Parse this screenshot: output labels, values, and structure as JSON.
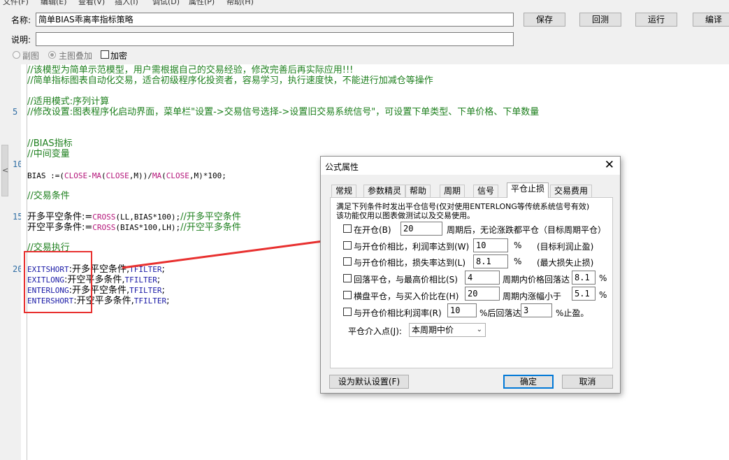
{
  "menu": [
    "文件(F)",
    "编辑(E)",
    "查看(V)",
    "插入(I)",
    "调试(D)",
    "属性(P)",
    "帮助(H)"
  ],
  "form": {
    "name_label": "名称:",
    "name_value": "简单BIAS乖离率指标策略",
    "desc_label": "说明:",
    "desc_value": "",
    "radio_sub": "副图",
    "radio_main": "主图叠加",
    "encrypt": "加密"
  },
  "toolbar": {
    "save": "保存",
    "backtest": "回测",
    "run": "运行",
    "compile": "编译"
  },
  "gutter": {
    "n5": "5",
    "n10": "10",
    "n15": "15",
    "n20": "20",
    "collapse": "<"
  },
  "code": {
    "l1": "//该模型为简单示范模型，用户需根据自己的交易经验，修改完善后再实际应用!!!",
    "l2": "//简单指标图表自动化交易，适合初级程序化投资者，容易学习，执行速度快，不能进行加减仓等操作",
    "l4": "//适用模式:序列计算",
    "l5": "//修改设置:图表程序化启动界面，菜单栏\"设置->交易信号选择->设置旧交易系统信号\"，可设置下单类型、下单价格、下单数量",
    "l8": "//BIAS指标",
    "l9": "//中间变量",
    "bias": {
      "a": "BIAS :=(",
      "close1": "CLOSE",
      "minus": "-",
      "ma1": "MA",
      "p1": "(",
      "close2": "CLOSE",
      "b": ",M))/",
      "ma2": "MA",
      "p2": "(",
      "close3": "CLOSE",
      "c": ",M)*100;"
    },
    "l13": "//交易条件",
    "l15a": "开多平空条件:=",
    "l15b": "CROSS",
    "l15c": "(LL,BIAS*100);",
    "l15d": "//开多平空条件",
    "l16a": "开空平多条件:=",
    "l16b": "CROSS",
    "l16c": "(BIAS*100,LH);",
    "l16d": "//开空平多条件",
    "l18": "//交易执行",
    "e1a": "EXITSHORT",
    "e1b": ":开多平空条件,",
    "e1c": "TFILTER",
    "e1d": ";",
    "e2a": "EXITLONG",
    "e2b": ":开空平多条件,",
    "e2c": "TFILTER",
    "e2d": ";",
    "e3a": "ENTERLONG",
    "e3b": ":开多平空条件,",
    "e3c": "TFILTER",
    "e3d": ";",
    "e4a": "ENTERSHORT",
    "e4b": ":开空平多条件,",
    "e4c": "TFILTER",
    "e4d": ";"
  },
  "dialog": {
    "title": "公式属性",
    "close": "✕",
    "tabs": [
      "常规",
      "参数精灵",
      "帮助",
      "周期",
      "信号",
      "平仓止损",
      "交易费用"
    ],
    "note1": "满足下列条件时发出平仓信号(仅对使用ENTERLONG等传统系统信号有效)",
    "note2": "该功能仅用以图表做测试以及交易使用。",
    "r1": {
      "a": "在开仓(B)",
      "v": "20",
      "b": "周期后，无论涨跌都平仓（目标周期平仓）"
    },
    "r2": {
      "a": "与开仓价相比，利润率达到(W)",
      "v": "10",
      "pct": "%",
      "b": "(目标利润止盈)"
    },
    "r3": {
      "a": "与开仓价相比，损失率达到(L)",
      "v": "8.1",
      "pct": "%",
      "b": "(最大损失止损)"
    },
    "r4": {
      "a": "回落平仓，与最高价相比(S)",
      "v": "4",
      "b": "周期内价格回落达",
      "v2": "8.1",
      "pct": "%"
    },
    "r5": {
      "a": "横盘平仓，与买入价比在(H)",
      "v": "20",
      "b": "周期内涨幅小于",
      "v2": "5.1",
      "pct": "%"
    },
    "r6": {
      "a": "与开仓价相比利润率(R)",
      "v": "10",
      "b": "%后回落达",
      "v2": "3",
      "c": "%止盈。"
    },
    "entry_label": "平仓介入点(J):",
    "entry_value": "本周期中价",
    "default_btn": "设为默认设置(F)",
    "ok_btn": "确定",
    "cancel_btn": "取消"
  },
  "colors": {
    "annotation": "#e8302f",
    "comment": "#1d7f1d",
    "function": "#b5177b",
    "keyword": "#1a1aa6"
  }
}
